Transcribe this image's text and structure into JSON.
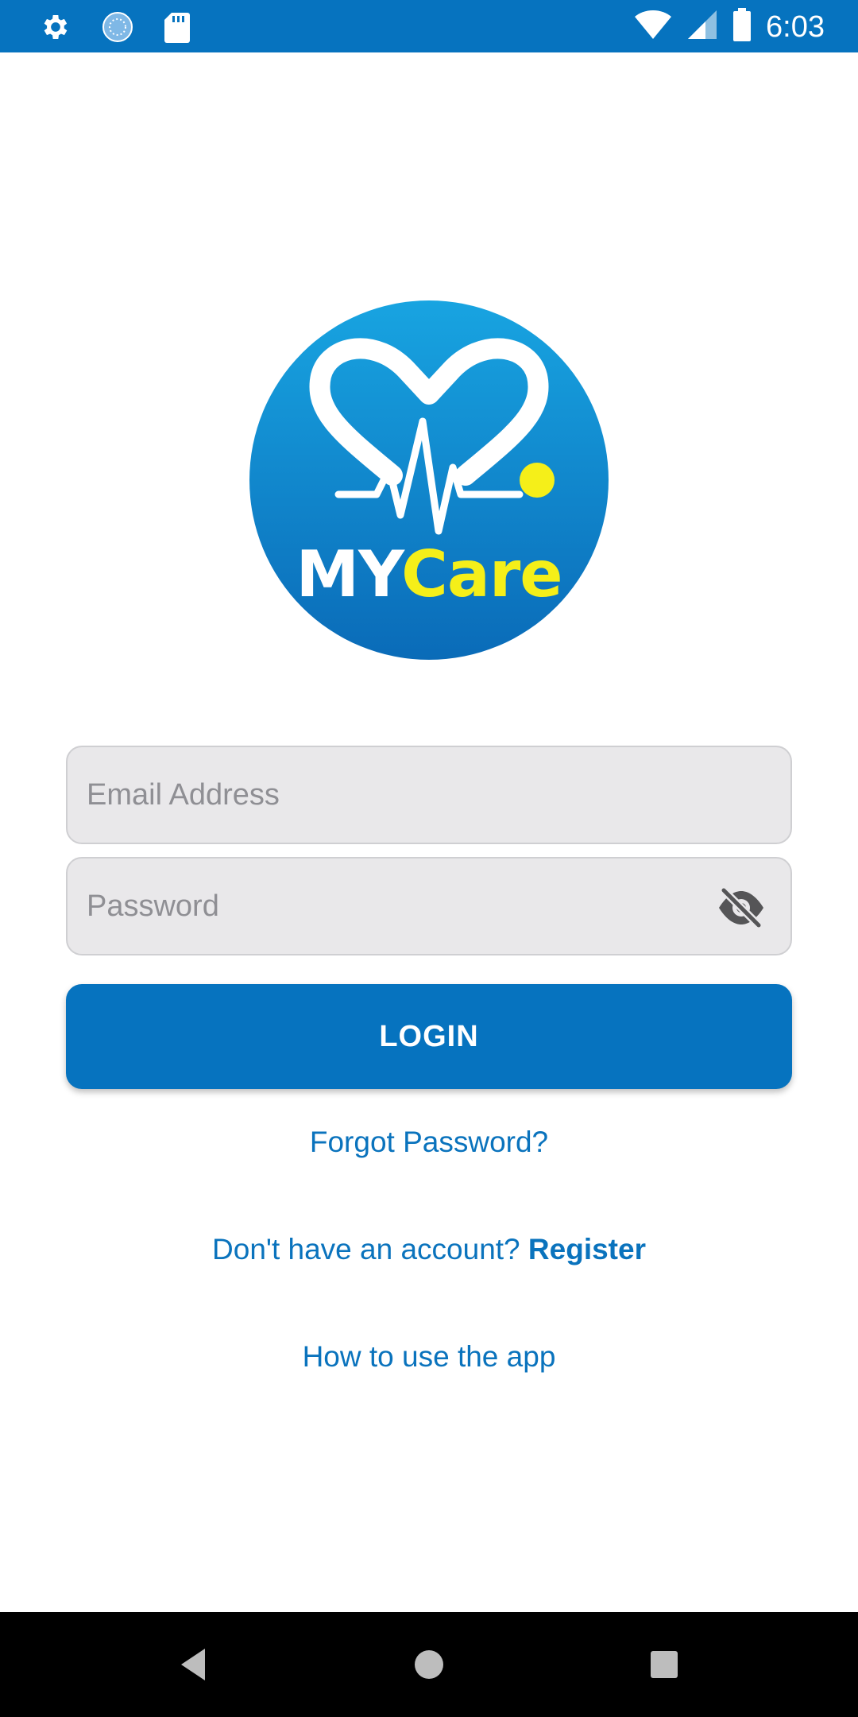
{
  "status_bar": {
    "time": "6:03",
    "left_icons": [
      "gear-icon",
      "spinner-icon",
      "sd-card-icon"
    ],
    "right_icons": [
      "wifi-icon",
      "cell-signal-icon",
      "battery-icon"
    ],
    "background": "#0673bf"
  },
  "logo": {
    "brand_my": "MY",
    "brand_care": "Care",
    "primary_color": "#0e8fd6",
    "accent_color": "#f5ef19"
  },
  "login_form": {
    "email_placeholder": "Email Address",
    "password_placeholder": "Password",
    "password_toggle_icon": "eye-off-icon",
    "login_label": "LOGIN"
  },
  "links": {
    "forgot_password": "Forgot Password?",
    "no_account_prefix": "Don't have an account? ",
    "register": "Register",
    "how_to_use": "How to use the app"
  },
  "colors": {
    "brand_blue": "#0673bf",
    "field_bg": "#e9e8ea",
    "link_blue": "#0a73bd"
  },
  "nav_bar": {
    "buttons": [
      "back-icon",
      "home-icon",
      "recents-icon"
    ]
  }
}
